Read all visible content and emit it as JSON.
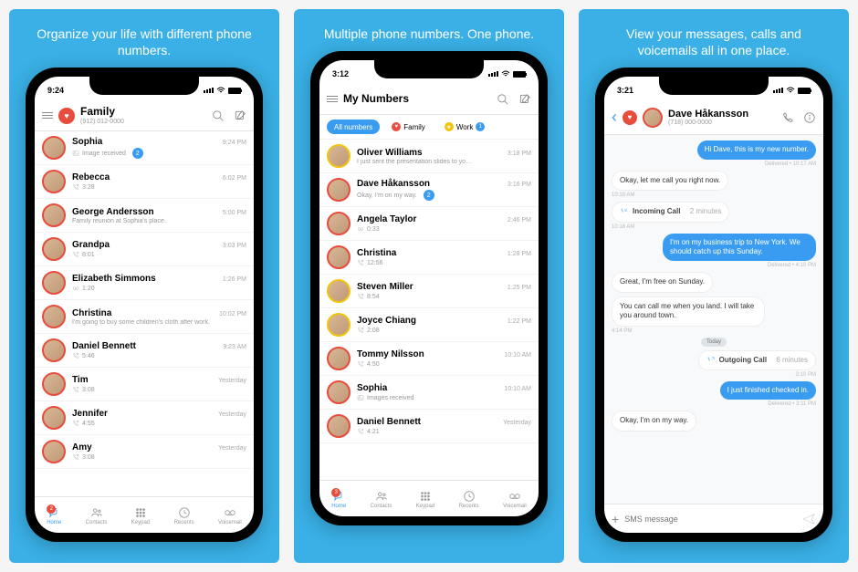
{
  "panels": [
    {
      "tagline": "Organize your life with different phone numbers."
    },
    {
      "tagline": "Multiple phone numbers. One phone."
    },
    {
      "tagline": "View your messages, calls and voicemails all in one place."
    }
  ],
  "status": {
    "time1": "9:24",
    "time2": "3:12",
    "time3": "3:21"
  },
  "s1": {
    "title": "Family",
    "subtitle": "(912) 012-0000",
    "rows": [
      {
        "name": "Sophia",
        "sub": "Image received",
        "time": "9:24 PM",
        "badge": "2",
        "icon": "image"
      },
      {
        "name": "Rebecca",
        "sub": "3:28",
        "time": "6:02 PM",
        "icon": "call"
      },
      {
        "name": "George Andersson",
        "sub": "Family reunion at Sophia's place.",
        "time": "5:00 PM",
        "icon": ""
      },
      {
        "name": "Grandpa",
        "sub": "8:01",
        "time": "3:03 PM",
        "icon": "call"
      },
      {
        "name": "Elizabeth Simmons",
        "sub": "1:20",
        "time": "1:26 PM",
        "icon": "voicemail"
      },
      {
        "name": "Christina",
        "sub": "I'm going to buy some children's cloth after work.",
        "time": "10:02 PM",
        "icon": ""
      },
      {
        "name": "Daniel Bennett",
        "sub": "5:46",
        "time": "9:23 AM",
        "icon": "call"
      },
      {
        "name": "Tim",
        "sub": "3:08",
        "time": "Yesterday",
        "icon": "call"
      },
      {
        "name": "Jennifer",
        "sub": "4:55",
        "time": "Yesterday",
        "icon": "call"
      },
      {
        "name": "Amy",
        "sub": "3:08",
        "time": "Yesterday",
        "icon": "call"
      }
    ]
  },
  "s2": {
    "title": "My Numbers",
    "chips": {
      "all": "All numbers",
      "family": "Family",
      "work": "Work",
      "work_count": "1"
    },
    "rows": [
      {
        "name": "Oliver Williams",
        "sub": "I just sent the presentation slides to yo…",
        "time": "3:18 PM",
        "ring": "yel"
      },
      {
        "name": "Dave Håkansson",
        "sub": "Okay, I'm on my way.",
        "time": "3:16 PM",
        "badge": "2",
        "ring": "red"
      },
      {
        "name": "Angela Taylor",
        "sub": "0:33",
        "time": "2:46 PM",
        "ring": "red",
        "icon": "voicemail"
      },
      {
        "name": "Christina",
        "sub": "12:56",
        "time": "1:28 PM",
        "ring": "red",
        "icon": "call"
      },
      {
        "name": "Steven Miller",
        "sub": "8:54",
        "time": "1:25 PM",
        "ring": "yel",
        "icon": "call"
      },
      {
        "name": "Joyce Chiang",
        "sub": "2:08",
        "time": "1:22 PM",
        "ring": "yel",
        "icon": "call"
      },
      {
        "name": "Tommy Nilsson",
        "sub": "4:50",
        "time": "10:10 AM",
        "ring": "red",
        "icon": "call"
      },
      {
        "name": "Sophia",
        "sub": "Images received",
        "time": "10:10 AM",
        "ring": "red",
        "icon": "image"
      },
      {
        "name": "Daniel Bennett",
        "sub": "4:21",
        "time": "Yesterday",
        "ring": "red",
        "icon": "call"
      }
    ]
  },
  "s3": {
    "contact": "Dave Håkansson",
    "phone": "(718) 000-0000",
    "composer_placeholder": "SMS message",
    "msgs": [
      {
        "type": "out",
        "text": "Hi Dave, this is my new number."
      },
      {
        "type": "meta-right",
        "text": "Delivered • 10:17 AM"
      },
      {
        "type": "in",
        "text": "Okay, let me call you right now."
      },
      {
        "type": "meta-left",
        "text": "10:18 AM"
      },
      {
        "type": "call-in",
        "text": "Incoming Call",
        "dur": "2 minutes"
      },
      {
        "type": "meta-left",
        "text": "10:18 AM"
      },
      {
        "type": "out",
        "text": "I'm on my business trip to New York. We should catch up this Sunday."
      },
      {
        "type": "meta-right",
        "text": "Delivered • 4:10 PM"
      },
      {
        "type": "in",
        "text": "Great, I'm free on Sunday."
      },
      {
        "type": "in",
        "text": "You can call me when you land. I will take you around town."
      },
      {
        "type": "meta-left",
        "text": "4:14 PM"
      },
      {
        "type": "sep",
        "text": "Today"
      },
      {
        "type": "call-out",
        "text": "Outgoing Call",
        "dur": "6 minutes"
      },
      {
        "type": "meta-right",
        "text": "3:10 PM"
      },
      {
        "type": "out",
        "text": "I just finished checked in."
      },
      {
        "type": "meta-right",
        "text": "Delivered • 3:11 PM"
      },
      {
        "type": "in",
        "text": "Okay, I'm on my way."
      }
    ]
  },
  "tabs": {
    "home": "Home",
    "contacts": "Contacts",
    "keypad": "Keypad",
    "recents": "Recents",
    "voicemail": "Voicemail",
    "badge1": "2",
    "badge2": "3"
  }
}
